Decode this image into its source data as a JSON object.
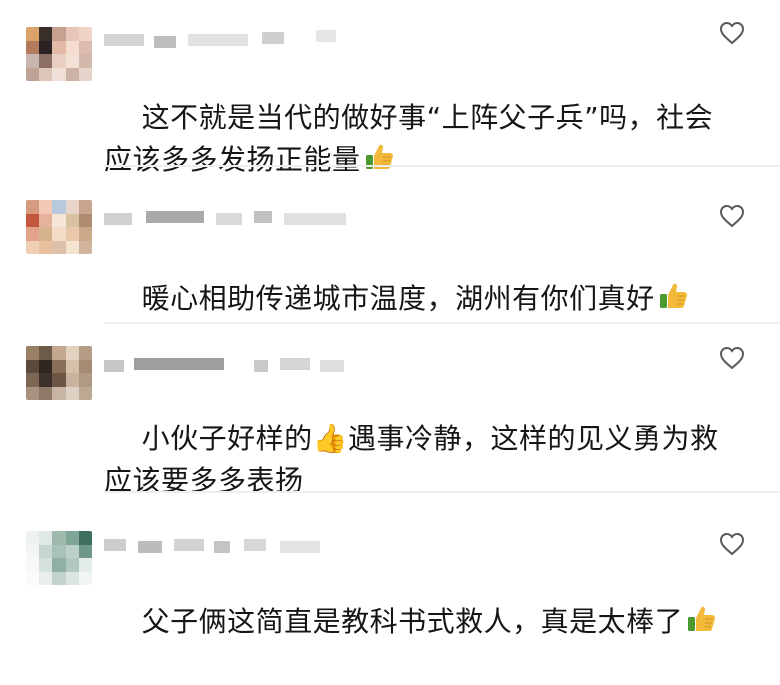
{
  "comments": [
    {
      "text": "这不就是当代的做好事“上阵父子兵”吗，社会应该多多发扬正能量",
      "emoji": "thumbs-up-icon",
      "avatar_colors": [
        "#d9a36a",
        "#3a2e2b",
        "#c8a08f",
        "#e7c7b9",
        "#f0d5c7",
        "#b37b5e",
        "#2a2223",
        "#e3b9a8",
        "#f4dccf",
        "#dcbcae",
        "#c9b6b0",
        "#8d6e63",
        "#e8cfc2",
        "#f3e1d8",
        "#d2b7ab",
        "#bfa397",
        "#ddc5ba",
        "#efdfd7",
        "#cdb2a6",
        "#e6d3ca"
      ]
    },
    {
      "text": "暖心相助传递城市温度，湖州有你们真好",
      "emoji": "thumbs-up-icon",
      "avatar_colors": [
        "#d69a7e",
        "#f3c9b5",
        "#b7c9dc",
        "#e8d4c8",
        "#c9a48f",
        "#c4583f",
        "#e7b29a",
        "#f6e6d8",
        "#d9c1a2",
        "#b08a70",
        "#e3a38a",
        "#d6b58e",
        "#f2dcc8",
        "#e9c9a9",
        "#caa988",
        "#f0cfb6",
        "#e8c09e",
        "#dcc0aa",
        "#f4e3d1",
        "#d1b49b"
      ]
    },
    {
      "text": "小伙子好样的👍遇事冷静，这样的见义勇为救应该要多多表扬",
      "emoji": "thumbs-up-icon",
      "avatar_colors": [
        "#9a8067",
        "#6e5a48",
        "#c2a88e",
        "#e4d2c0",
        "#b39b84",
        "#5b4a3c",
        "#2f2621",
        "#8a705a",
        "#d7c0aa",
        "#a68b73",
        "#7c6654",
        "#3c302a",
        "#6b5646",
        "#c9b39f",
        "#b09a86",
        "#a79380",
        "#8f7a67",
        "#c7b4a3",
        "#ddd0c4",
        "#bca893"
      ]
    },
    {
      "text": "父子俩这简直是教科书式救人，真是太棒了",
      "emoji": "thumbs-up-icon",
      "avatar_colors": [
        "#eef2f0",
        "#dfe8e4",
        "#9fb9ad",
        "#7ea595",
        "#3f6f5f",
        "#f4f6f5",
        "#c7d6cf",
        "#a9c2b7",
        "#bcd0c7",
        "#6d9887",
        "#f7f8f7",
        "#d5e1dc",
        "#8fb0a2",
        "#b2c8be",
        "#e4ece8",
        "#fafbfa",
        "#e9efec",
        "#c2d4cc",
        "#dbe5e0",
        "#f1f5f3"
      ]
    }
  ]
}
